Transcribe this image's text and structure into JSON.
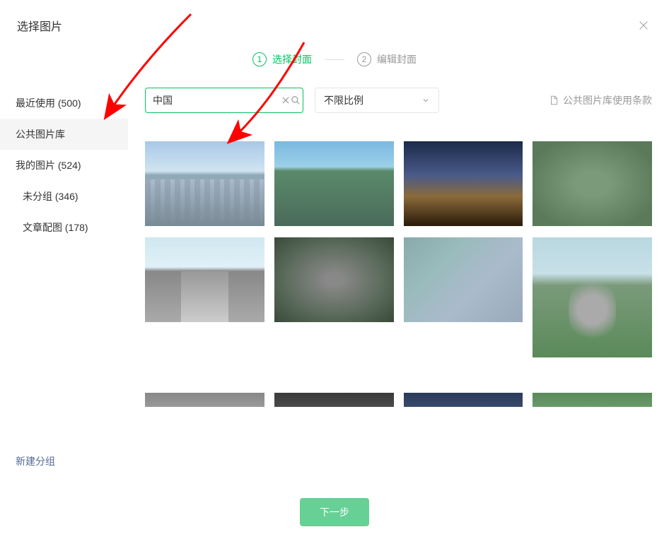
{
  "modal": {
    "title": "选择图片"
  },
  "steps": {
    "step1": {
      "num": "1",
      "label": "选择封面"
    },
    "step2": {
      "num": "2",
      "label": "编辑封面"
    }
  },
  "sidebar": {
    "recent": "最近使用 (500)",
    "public": "公共图片库",
    "mine": "我的图片 (524)",
    "ungrouped": "未分组 (346)",
    "article": "文章配图 (178)",
    "newGroup": "新建分组"
  },
  "search": {
    "value": "中国"
  },
  "ratio": {
    "label": "不限比例"
  },
  "terms": {
    "label": "公共图片库使用条款"
  },
  "footer": {
    "next": "下一步"
  }
}
